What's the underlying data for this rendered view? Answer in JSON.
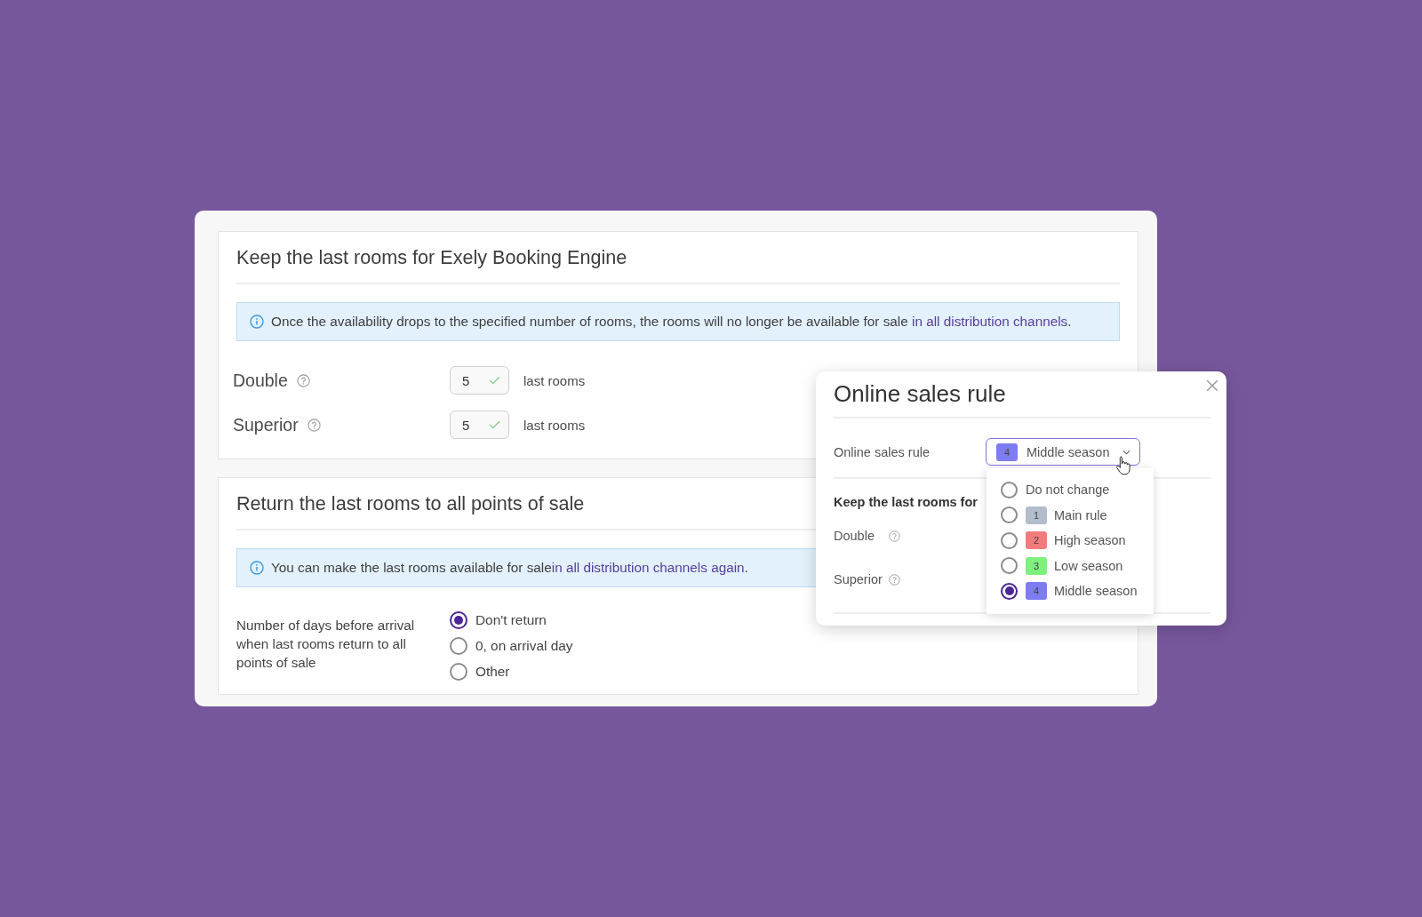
{
  "sections": [
    {
      "kind": "rooms",
      "title": "Keep the last rooms for Exely Booking Engine",
      "info": {
        "text": "Once the availability drops to the specified number of rooms, the rooms will no longer be available for sale ",
        "link": "in all distribution channels",
        "after": "."
      },
      "rooms": [
        {
          "name": "Double",
          "value": "5",
          "unit": "last rooms"
        },
        {
          "name": "Superior",
          "value": "5",
          "unit": "last rooms"
        }
      ]
    },
    {
      "kind": "return",
      "title": "Return the last rooms to all points of sale",
      "info": {
        "text": "You can make the last rooms available for sale",
        "link": "in all distribution channels again",
        "after": "."
      },
      "field_label": "Number of days before arrival when last rooms return to all points of sale",
      "options": [
        {
          "label": "Don't return",
          "selected": true
        },
        {
          "label": "0, on arrival day",
          "selected": false
        },
        {
          "label": "Other",
          "selected": false
        }
      ]
    }
  ],
  "dialog": {
    "title": "Online sales rule",
    "rule_label": "Online sales rule",
    "select": {
      "badge": "4",
      "color": "#7d7cf2",
      "value": "Middle season",
      "expanded": true
    },
    "options": [
      {
        "label": "Do not change",
        "selected": false
      },
      {
        "badge": "1",
        "color": "#b3bccb",
        "label": "Main rule",
        "selected": false
      },
      {
        "badge": "2",
        "color": "#f47b7b",
        "label": "High season",
        "selected": false
      },
      {
        "badge": "3",
        "color": "#7df07d",
        "label": "Low season",
        "selected": false
      },
      {
        "badge": "4",
        "color": "#7d7cf2",
        "label": "Middle season",
        "selected": true
      }
    ],
    "section_title": "Keep the last rooms for",
    "rooms": [
      {
        "name": "Double"
      },
      {
        "name": "Superior"
      }
    ]
  }
}
